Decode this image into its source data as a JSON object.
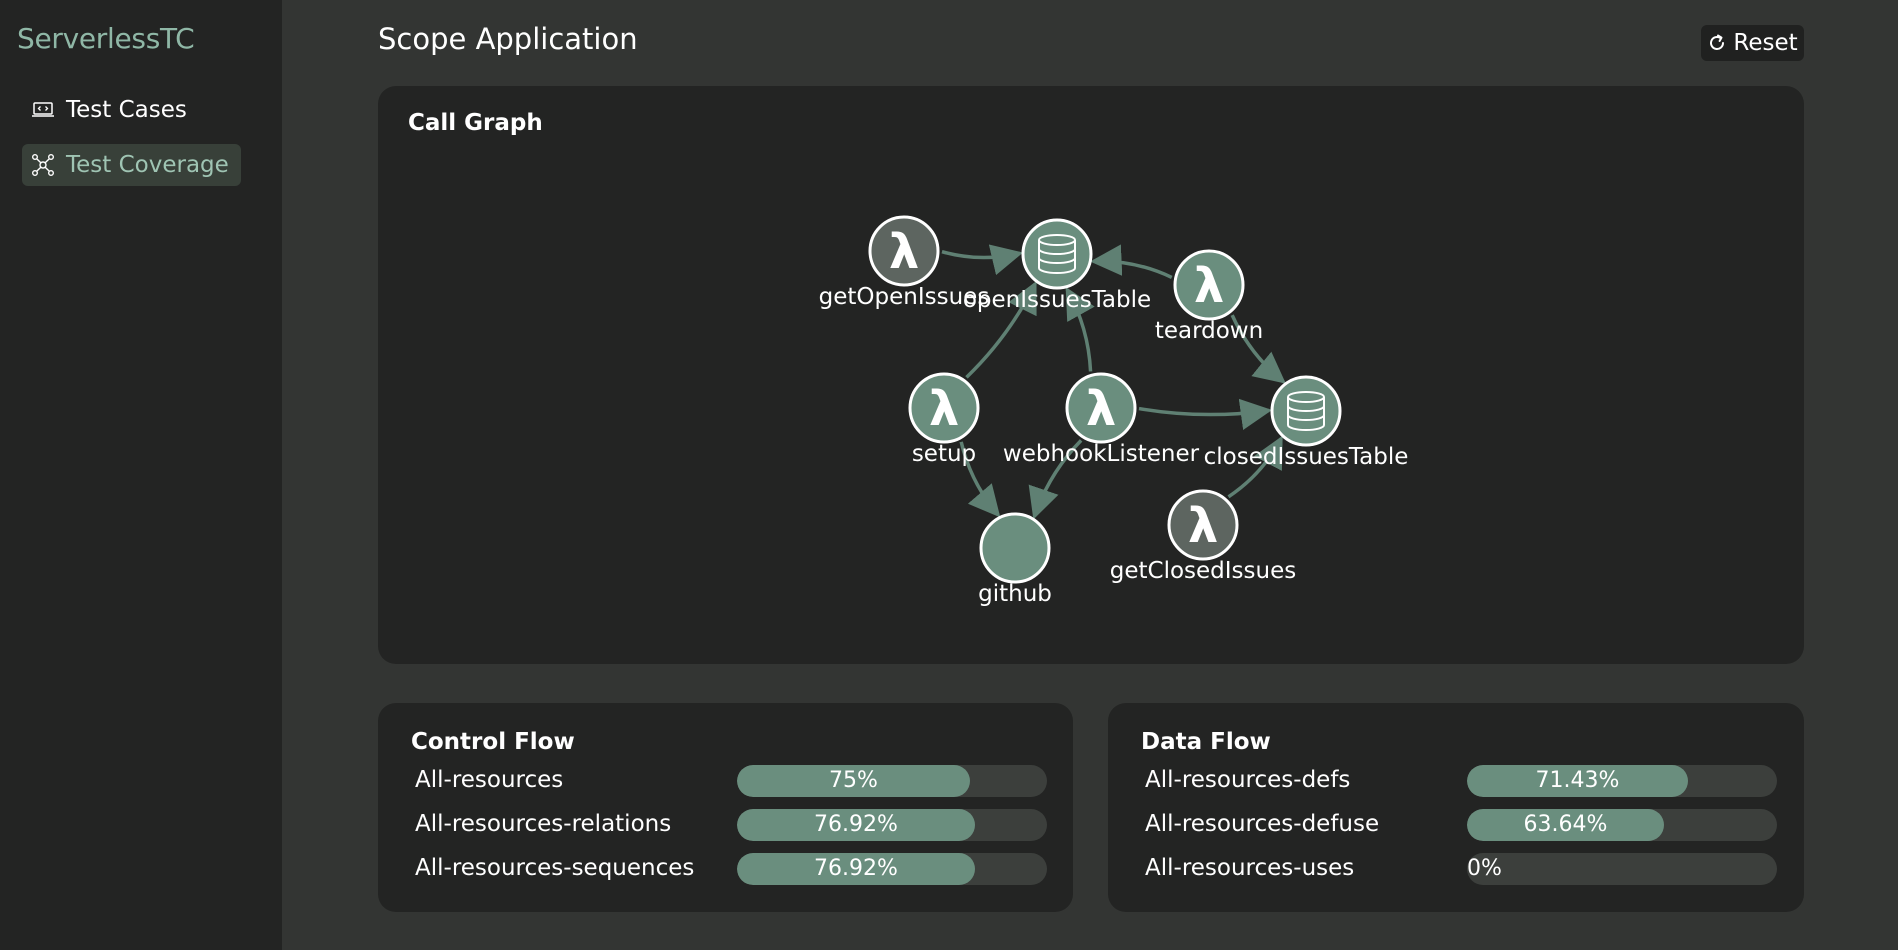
{
  "app": {
    "brand": "ServerlessTC"
  },
  "sidebar": {
    "items": [
      {
        "label": "Test Cases",
        "icon": "laptop-code-icon",
        "active": false
      },
      {
        "label": "Test Coverage",
        "icon": "graph-nodes-icon",
        "active": true
      }
    ]
  },
  "header": {
    "title": "Scope Application",
    "reset_label": "Reset",
    "reset_icon": "refresh-icon"
  },
  "call_graph": {
    "title": "Call Graph",
    "nodes": [
      {
        "id": "getOpenIssues",
        "label": "getOpenIssues",
        "kind": "lambda"
      },
      {
        "id": "openIssuesTable",
        "label": "openIssuesTable",
        "kind": "table"
      },
      {
        "id": "teardown",
        "label": "teardown",
        "kind": "lambda"
      },
      {
        "id": "setup",
        "label": "setup",
        "kind": "lambda"
      },
      {
        "id": "webhookListener",
        "label": "webhookListener",
        "kind": "lambda"
      },
      {
        "id": "closedIssuesTable",
        "label": "closedIssuesTable",
        "kind": "table"
      },
      {
        "id": "github",
        "label": "github",
        "kind": "external"
      },
      {
        "id": "getClosedIssues",
        "label": "getClosedIssues",
        "kind": "lambda"
      }
    ],
    "edges": [
      {
        "from": "getOpenIssues",
        "to": "openIssuesTable"
      },
      {
        "from": "teardown",
        "to": "openIssuesTable"
      },
      {
        "from": "teardown",
        "to": "closedIssuesTable"
      },
      {
        "from": "setup",
        "to": "openIssuesTable"
      },
      {
        "from": "setup",
        "to": "github"
      },
      {
        "from": "webhookListener",
        "to": "openIssuesTable"
      },
      {
        "from": "webhookListener",
        "to": "closedIssuesTable"
      },
      {
        "from": "webhookListener",
        "to": "github"
      },
      {
        "from": "getClosedIssues",
        "to": "closedIssuesTable"
      }
    ],
    "colors": {
      "covered": "#6a8e7e",
      "uncovered": "#5d6560",
      "edge": "#5f8073"
    }
  },
  "control_flow": {
    "title": "Control Flow",
    "metrics": [
      {
        "label": "All-resources",
        "value": 0.75,
        "text": "75%"
      },
      {
        "label": "All-resources-relations",
        "value": 0.7692,
        "text": "76.92%"
      },
      {
        "label": "All-resources-sequences",
        "value": 0.7692,
        "text": "76.92%"
      }
    ]
  },
  "data_flow": {
    "title": "Data Flow",
    "metrics": [
      {
        "label": "All-resources-defs",
        "value": 0.7143,
        "text": "71.43%"
      },
      {
        "label": "All-resources-defuse",
        "value": 0.6364,
        "text": "63.64%"
      },
      {
        "label": "All-resources-uses",
        "value": 0,
        "text": "0%"
      }
    ]
  }
}
